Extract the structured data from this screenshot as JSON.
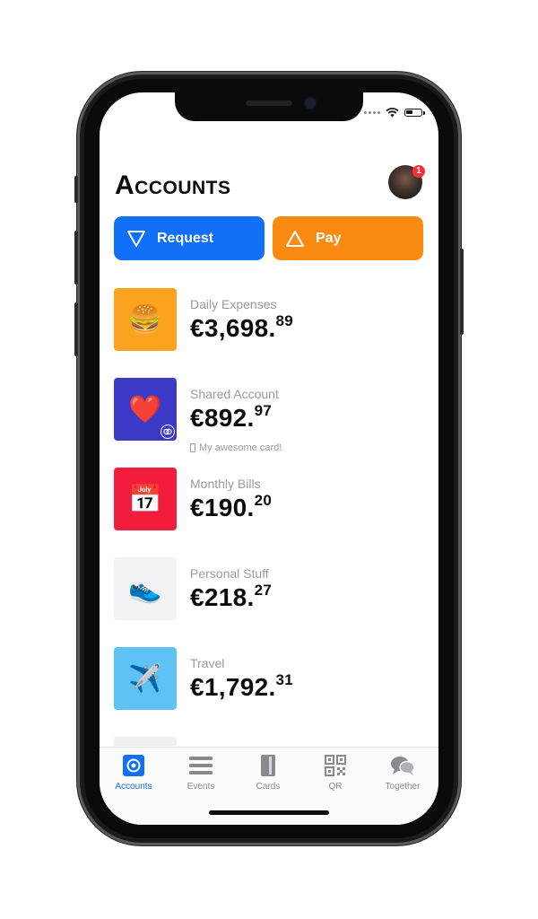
{
  "header": {
    "title": "Accounts",
    "notification_count": "1"
  },
  "actions": {
    "request_label": "Request",
    "pay_label": "Pay"
  },
  "accounts": [
    {
      "name": "Daily Expenses",
      "amount_main": "€3,698.",
      "amount_cents": "89",
      "icon": "hamburger-emoji",
      "emoji": "🍔",
      "color": "#fba21e"
    },
    {
      "name": "Shared Account",
      "amount_main": "€892.",
      "amount_cents": "97",
      "icon": "heart-emoji",
      "emoji": "❤️",
      "color": "#3c39c7",
      "card_label": "My awesome card!"
    },
    {
      "name": "Monthly Bills",
      "amount_main": "€190.",
      "amount_cents": "20",
      "icon": "calendar-emoji",
      "emoji": "📅",
      "color": "#f21c3d"
    },
    {
      "name": "Personal Stuff",
      "amount_main": "€218.",
      "amount_cents": "27",
      "icon": "sneaker-emoji",
      "emoji": "👟",
      "color": "#f2f2f4"
    },
    {
      "name": "Travel",
      "amount_main": "€1,792.",
      "amount_cents": "31",
      "icon": "airplane-emoji",
      "emoji": "✈️",
      "color": "#5ec2f5"
    }
  ],
  "tabs": [
    {
      "label": "Accounts",
      "icon": "accounts-icon",
      "active": true
    },
    {
      "label": "Events",
      "icon": "list-icon",
      "active": false
    },
    {
      "label": "Cards",
      "icon": "card-icon",
      "active": false
    },
    {
      "label": "QR",
      "icon": "qr-icon",
      "active": false
    },
    {
      "label": "Together",
      "icon": "chat-bubbles-icon",
      "active": false
    }
  ],
  "colors": {
    "accent_blue": "#1170f7",
    "accent_orange": "#fb8a12",
    "badge_red": "#ff2d37"
  }
}
